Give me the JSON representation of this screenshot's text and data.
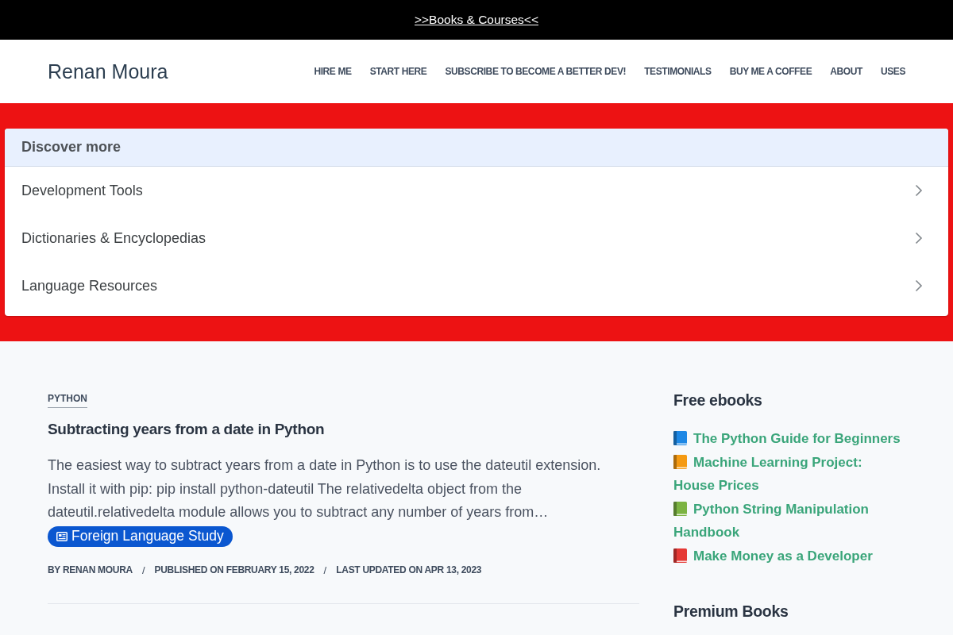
{
  "top_banner": {
    "link": ">>Books & Courses<<"
  },
  "header": {
    "site_title": "Renan Moura",
    "nav": [
      "HIRE ME",
      "START HERE",
      "SUBSCRIBE TO BECOME A BETTER DEV!",
      "TESTIMONIALS",
      "BUY ME A COFFEE",
      "ABOUT",
      "USES"
    ]
  },
  "discover_more": {
    "title": "Discover more",
    "items": [
      "Development Tools",
      "Dictionaries & Encyclopedias",
      "Language Resources"
    ]
  },
  "post": {
    "category": "PYTHON",
    "title": "Subtracting years from a date in Python",
    "excerpt": "The easiest way to subtract years from a date in Python is to use the dateutil extension. Install it with pip: pip install python-dateutil The relativedelta object from the dateutil.relativedelta module allows you to subtract any number of years from…",
    "tag": "Foreign Language Study",
    "meta": [
      {
        "kind": "text",
        "text": "BY RENAN MOURA"
      },
      {
        "kind": "separator",
        "text": "/"
      },
      {
        "kind": "text",
        "text": "PUBLISHED ON FEBRUARY 15, 2022"
      },
      {
        "kind": "separator",
        "text": "/"
      },
      {
        "kind": "text",
        "text": "LAST UPDATED ON APR 13, 2023"
      }
    ]
  },
  "sidebar": {
    "free_ebooks": {
      "title": "Free ebooks",
      "items": [
        {
          "title": "The Python Guide for Beginners",
          "color": "#1e88e5"
        },
        {
          "title": "Machine Learning Project: House Prices",
          "color": "#f59a12"
        },
        {
          "title": "Python String Manipulation Handbook",
          "color": "#7cb342"
        },
        {
          "title": "Make Money as a Developer",
          "color": "#e53935"
        }
      ]
    },
    "premium_books": {
      "title": "Premium Books"
    }
  }
}
